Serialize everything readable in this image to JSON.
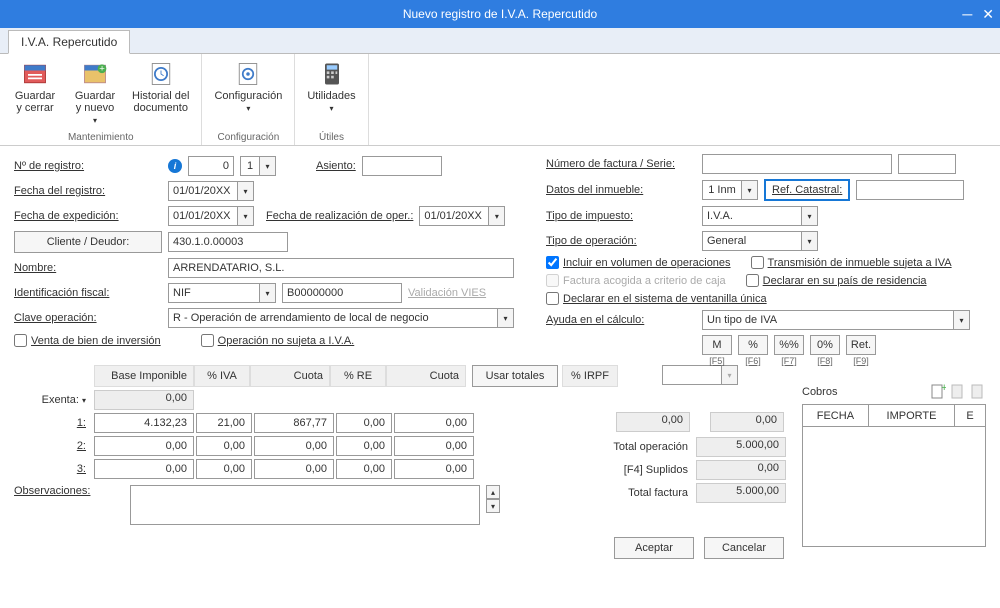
{
  "window": {
    "title": "Nuevo registro de I.V.A. Repercutido"
  },
  "tabstrip": {
    "tab1": "I.V.A. Repercutido"
  },
  "ribbon": {
    "g1_label": "Mantenimiento",
    "save_close": "Guardar\ny cerrar",
    "save_new": "Guardar\ny nuevo",
    "history": "Historial del\ndocumento",
    "g2_label": "Configuración",
    "config": "Configuración",
    "g3_label": "Útiles",
    "util": "Utilidades"
  },
  "left": {
    "nregistro_lbl": "Nº de registro:",
    "nregistro_val": "0",
    "nregistro_seq": "1",
    "asiento_lbl": "Asiento:",
    "asiento_val": "",
    "fecha_reg_lbl": "Fecha del registro:",
    "fecha_reg_val": "01/01/20XX",
    "fecha_exp_lbl": "Fecha de expedición:",
    "fecha_exp_val": "01/01/20XX",
    "fecha_real_lbl": "Fecha de realización de oper.:",
    "fecha_real_val": "01/01/20XX",
    "cliente_btn": "Cliente / Deudor:",
    "cliente_val": "430.1.0.00003",
    "nombre_lbl": "Nombre:",
    "nombre_val": "ARRENDATARIO, S.L.",
    "idfiscal_lbl": "Identificación fiscal:",
    "idfiscal_type": "NIF",
    "idfiscal_val": "B00000000",
    "valid_vies": "Validación VIES",
    "clave_lbl": "Clave operación:",
    "clave_val": "R - Operación de arrendamiento de local de negocio",
    "venta_inv": "Venta de bien de inversión",
    "op_no_sujeta": "Operación no sujeta a I.V.A."
  },
  "right": {
    "numfact_lbl": "Número de factura / Serie:",
    "numfact_val": "",
    "serie_val": "",
    "inmueble_lbl": "Datos del inmueble:",
    "inmueble_val": "1 Inm",
    "refcat_lbl": "Ref. Catastral:",
    "refcat_val": "",
    "tipoimp_lbl": "Tipo de impuesto:",
    "tipoimp_val": "I.V.A.",
    "tipoop_lbl": "Tipo de operación:",
    "tipoop_val": "General",
    "incl_vol": "Incluir en volumen de operaciones",
    "trans_inm": "Transmisión de inmueble sujeta a IVA",
    "fact_caja": "Factura acogida a criterio de caja",
    "decl_pais": "Declarar en su país de residencia",
    "decl_vent": "Declarar en el sistema de ventanilla única",
    "ayuda_lbl": "Ayuda en el cálculo:",
    "ayuda_val": "Un tipo de IVA",
    "btn_M": "M",
    "fk_M": "[F5]",
    "btn_pct": "%",
    "fk_pct": "[F6]",
    "btn_pp": "%%",
    "fk_pp": "[F7]",
    "btn_0": "0%",
    "fk_0": "[F8]",
    "btn_ret": "Ret.",
    "fk_ret": "[F9]"
  },
  "grid": {
    "h_base": "Base Imponible",
    "h_iva": "% IVA",
    "h_cuota1": "Cuota",
    "h_re": "% RE",
    "h_cuota2": "Cuota",
    "usar_tot": "Usar totales",
    "h_irpf": "% IRPF",
    "row_ex": "Exenta:",
    "row_1": "1:",
    "row_2": "2:",
    "row_3": "3:",
    "ex_base": "0,00",
    "r1": {
      "base": "4.132,23",
      "iva": "21,00",
      "cuota1": "867,77",
      "re": "0,00",
      "cuota2": "0,00"
    },
    "r2": {
      "base": "0,00",
      "iva": "0,00",
      "cuota1": "0,00",
      "re": "0,00",
      "cuota2": "0,00"
    },
    "r3": {
      "base": "0,00",
      "iva": "0,00",
      "cuota1": "0,00",
      "re": "0,00",
      "cuota2": "0,00"
    },
    "irpf_cuota": "0,00",
    "irpf_amt": "0,00"
  },
  "totals": {
    "t_op_lbl": "Total operación",
    "t_op": "5.000,00",
    "t_sup_lbl": "[F4] Suplidos",
    "t_sup": "0,00",
    "t_fac_lbl": "Total factura",
    "t_fac": "5.000,00"
  },
  "obs_lbl": "Observaciones:",
  "obs_val": "",
  "buttons": {
    "aceptar": "Aceptar",
    "cancelar": "Cancelar"
  },
  "cobros": {
    "title": "Cobros",
    "col_fecha": "FECHA",
    "col_importe": "IMPORTE",
    "col_e": "E"
  }
}
